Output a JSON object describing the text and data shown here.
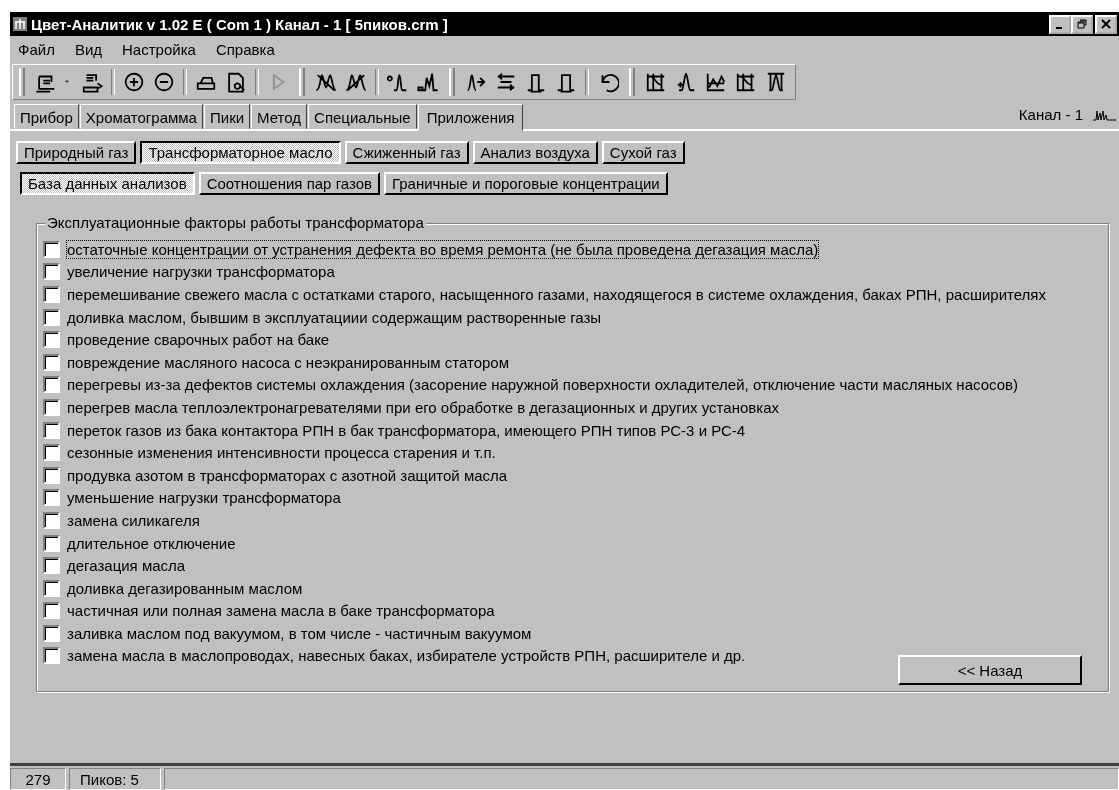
{
  "window": {
    "title": "Цвет-Аналитик v 1.02 E ( Com 1 ) Канал - 1 [ 5пиков.crm ]"
  },
  "menu": [
    "Файл",
    "Вид",
    "Настройка",
    "Справка"
  ],
  "tabs": [
    {
      "label": "Прибор",
      "selected": false
    },
    {
      "label": "Хроматограмма",
      "selected": false
    },
    {
      "label": "Пики",
      "selected": false
    },
    {
      "label": "Метод",
      "selected": false
    },
    {
      "label": "Специальные",
      "selected": false
    },
    {
      "label": "Приложения",
      "selected": true
    }
  ],
  "channel_label": "Канал - 1",
  "app_tabs": [
    {
      "label": "Природный газ",
      "selected": false
    },
    {
      "label": "Трансформаторное масло",
      "selected": true
    },
    {
      "label": "Сжиженный газ",
      "selected": false
    },
    {
      "label": "Анализ воздуха",
      "selected": false
    },
    {
      "label": "Сухой газ",
      "selected": false
    }
  ],
  "sub_tabs": [
    {
      "label": "База данных анализов",
      "selected": true
    },
    {
      "label": "Соотношения пар газов",
      "selected": false
    },
    {
      "label": "Граничные и пороговые концентрации",
      "selected": false
    }
  ],
  "group": {
    "title": "Эксплуатационные факторы работы трансформатора",
    "items": [
      {
        "label": "остаточные концентрации от устранения дефекта во время ремонта (не была проведена дегазация масла)",
        "checked": false,
        "focused": true
      },
      {
        "label": "увеличение нагрузки трансформатора",
        "checked": false,
        "focused": false
      },
      {
        "label": "перемешивание свежего масла с остатками старого, насыщенного газами, находящегося в системе охлаждения, баках РПН, расширителях",
        "checked": false,
        "focused": false
      },
      {
        "label": "доливка маслом, бывшим в эксплуатациии содержащим растворенные газы",
        "checked": false,
        "focused": false
      },
      {
        "label": "проведение сварочных работ на баке",
        "checked": false,
        "focused": false
      },
      {
        "label": "повреждение масляного насоса с неэкранированным статором",
        "checked": false,
        "focused": false
      },
      {
        "label": "перегревы из-за дефектов системы охлаждения (засорение наружной поверхности охладителей, отключение части масляных насосов)",
        "checked": false,
        "focused": false
      },
      {
        "label": "перегрев масла теплоэлектронагревателями при его обработке в дегазационных и других установках",
        "checked": false,
        "focused": false
      },
      {
        "label": "переток газов из бака контактора РПН в бак трансформатора, имеющего РПН типов РС-3 и РС-4",
        "checked": false,
        "focused": false
      },
      {
        "label": "сезонные изменения интенсивности процесса старения и т.п.",
        "checked": false,
        "focused": false
      },
      {
        "label": "продувка азотом в трансформаторах с азотной защитой масла",
        "checked": false,
        "focused": false
      },
      {
        "label": "уменьшение нагрузки трансформатора",
        "checked": false,
        "focused": false
      },
      {
        "label": "замена силикагеля",
        "checked": false,
        "focused": false
      },
      {
        "label": "длительное отключение",
        "checked": false,
        "focused": false
      },
      {
        "label": "дегазация масла",
        "checked": false,
        "focused": false
      },
      {
        "label": "доливка дегазированным маслом",
        "checked": false,
        "focused": false
      },
      {
        "label": "частичная или полная замена масла в баке трансформатора",
        "checked": false,
        "focused": false
      },
      {
        "label": "заливка маслом под вакуумом, в том числе - частичным вакуумом",
        "checked": false,
        "focused": false
      },
      {
        "label": "замена масла в маслопроводах, навесных баках, избирателе устройств РПН, расширителе и др.",
        "checked": false,
        "focused": false
      }
    ],
    "back_button": "<< Назад"
  },
  "status_bar": [
    "279",
    "Пиков: 5"
  ]
}
